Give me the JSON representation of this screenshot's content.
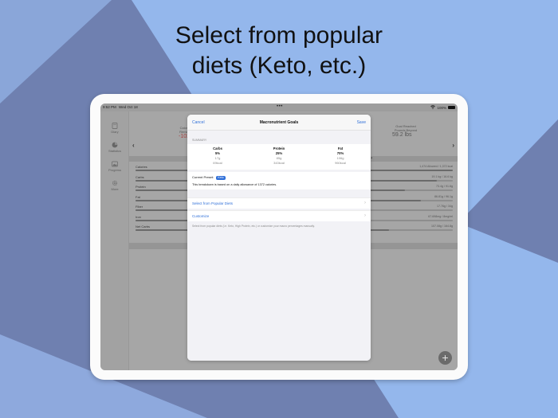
{
  "headline": {
    "line1": "Select from popular",
    "line2": "diets (Keto, etc.)"
  },
  "colors": {
    "background": "#94b7ec",
    "shape_dark": "#6f80b0",
    "accent": "#2f6fd8"
  },
  "status_bar": {
    "time": "9:52 PM",
    "date": "Wed Oct 18",
    "center": "•••",
    "battery": "100%"
  },
  "sidebar": {
    "items": [
      {
        "label": "Diary",
        "icon": "diary-icon"
      },
      {
        "label": "Statistics",
        "icon": "pie-chart-icon"
      },
      {
        "label": "Progress",
        "icon": "image-icon"
      },
      {
        "label": "More",
        "icon": "gear-icon"
      }
    ]
  },
  "app_header": {
    "left_label_1": "Calorie",
    "left_label_2": "Remain",
    "left_value": "-102",
    "right_label_1": "Goal Reached",
    "right_label_2": "Pounds Beyond",
    "right_value": "59.2 lbs",
    "more_dots": "•••"
  },
  "nutrients": [
    {
      "label": "Calories",
      "value": "1,474 Allowed / 1,372 kcal",
      "progress": 1.0
    },
    {
      "label": "Carbs",
      "value": "19.1 kg / 16.6 kg",
      "progress": 0.95
    },
    {
      "label": "Protein",
      "value": "73.4g / 91.6g",
      "progress": 0.85
    },
    {
      "label": "Fat",
      "value": "86.81g / 96.1g",
      "progress": 0.9
    },
    {
      "label": "Fiber",
      "value": "17.76g / 34g",
      "progress": 0.5
    },
    {
      "label": "Iron",
      "value": "67.698mg / 8mg/ml",
      "progress": 0.6
    },
    {
      "label": "Net Carbs",
      "value": "107.08g / 164.8g",
      "progress": 0.8
    }
  ],
  "modal": {
    "cancel": "Cancel",
    "title": "Macronutrient Goals",
    "save": "Save",
    "summary_header": "SUMMARY",
    "macros": [
      {
        "name": "Carbs",
        "percent": "5%",
        "grams": "17g",
        "kcal": "69kcal"
      },
      {
        "name": "Protein",
        "percent": "25%",
        "grams": "85g",
        "kcal": "343kcal"
      },
      {
        "name": "Fat",
        "percent": "70%",
        "grams": "106g",
        "kcal": "960kcal"
      }
    ],
    "preset_label": "Current Preset:",
    "preset_value": "Keto",
    "breakdown_text": "This breakdown is based on a daily allowance of 1372 calories.",
    "select_diets": "Select from Popular Diets",
    "customize": "Customize",
    "footnote": "Select from popular diets (i.e. Keto, High Protein, etc.) or customize your macro percentages manually.",
    "chevron": "›"
  },
  "fab": {
    "label": "+"
  }
}
